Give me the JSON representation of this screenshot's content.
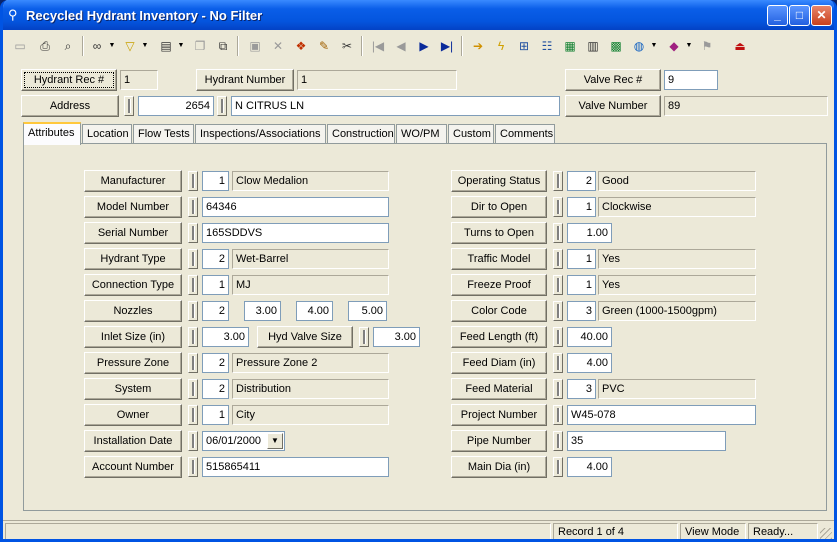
{
  "window": {
    "title": "Recycled Hydrant Inventory - No Filter"
  },
  "toolbar": {
    "icons": [
      "new-icon",
      "print-icon",
      "print-preview-icon",
      "binoculars-icon",
      "filter-icon",
      "form-icon",
      "copy-icon",
      "save-icon",
      "delete-icon",
      "layers-icon",
      "edit-icon",
      "cut-icon",
      "first-record-icon",
      "previous-record-icon",
      "next-record-icon",
      "last-record-icon",
      "arrow-icon",
      "lightning-icon",
      "map-icon",
      "tree-icon",
      "report-icon",
      "calculator-icon",
      "map-view-icon",
      "globe-icon",
      "book-icon",
      "flag-icon",
      "exit-icon"
    ]
  },
  "header": {
    "hydrant_rec_label": "Hydrant Rec #",
    "hydrant_rec_value": "1",
    "hydrant_number_label": "Hydrant Number",
    "hydrant_number_value": "1",
    "valve_rec_label": "Valve Rec #",
    "valve_rec_value": "9",
    "address_label": "Address",
    "address_number": "2654",
    "address_street": "N CITRUS LN",
    "valve_number_label": "Valve Number",
    "valve_number_value": "89"
  },
  "tabs": [
    "Attributes",
    "Location",
    "Flow Tests",
    "Inspections/Associations",
    "Construction",
    "WO/PM",
    "Custom",
    "Comments"
  ],
  "left": {
    "manufacturer": {
      "label": "Manufacturer",
      "code": "1",
      "value": "Clow Medalion"
    },
    "model_number": {
      "label": "Model Number",
      "value": "64346"
    },
    "serial_number": {
      "label": "Serial Number",
      "value": "165SDDVS"
    },
    "hydrant_type": {
      "label": "Hydrant Type",
      "code": "2",
      "value": "Wet-Barrel"
    },
    "connection_type": {
      "label": "Connection Type",
      "code": "1",
      "value": "MJ"
    },
    "nozzles": {
      "label": "Nozzles",
      "count": "2",
      "n1": "3.00",
      "n2": "4.00",
      "n3": "5.00"
    },
    "inlet_size": {
      "label": "Inlet Size (in)",
      "value": "3.00"
    },
    "hyd_valve_size": {
      "label": "Hyd Valve Size",
      "value": "3.00"
    },
    "pressure_zone": {
      "label": "Pressure Zone",
      "code": "2",
      "value": "Pressure Zone 2"
    },
    "system": {
      "label": "System",
      "code": "2",
      "value": "Distribution"
    },
    "owner": {
      "label": "Owner",
      "code": "1",
      "value": "City"
    },
    "installation_date": {
      "label": "Installation Date",
      "value": "06/01/2000"
    },
    "account_number": {
      "label": "Account Number",
      "value": "515865411"
    }
  },
  "right": {
    "operating_status": {
      "label": "Operating Status",
      "code": "2",
      "value": "Good"
    },
    "dir_to_open": {
      "label": "Dir to Open",
      "code": "1",
      "value": "Clockwise"
    },
    "turns_to_open": {
      "label": "Turns to Open",
      "value": "1.00"
    },
    "traffic_model": {
      "label": "Traffic Model",
      "code": "1",
      "value": "Yes"
    },
    "freeze_proof": {
      "label": "Freeze Proof",
      "code": "1",
      "value": "Yes"
    },
    "color_code": {
      "label": "Color Code",
      "code": "3",
      "value": "Green (1000-1500gpm)"
    },
    "feed_length": {
      "label": "Feed Length (ft)",
      "value": "40.00"
    },
    "feed_diam": {
      "label": "Feed Diam (in)",
      "value": "4.00"
    },
    "feed_material": {
      "label": "Feed Material",
      "code": "3",
      "value": "PVC"
    },
    "project_number": {
      "label": "Project Number",
      "value": "W45-078"
    },
    "pipe_number": {
      "label": "Pipe Number",
      "value": "35"
    },
    "main_dia": {
      "label": "Main Dia (in)",
      "value": "4.00"
    }
  },
  "status": {
    "record": "Record 1 of 4",
    "mode": "View Mode",
    "state": "Ready..."
  }
}
